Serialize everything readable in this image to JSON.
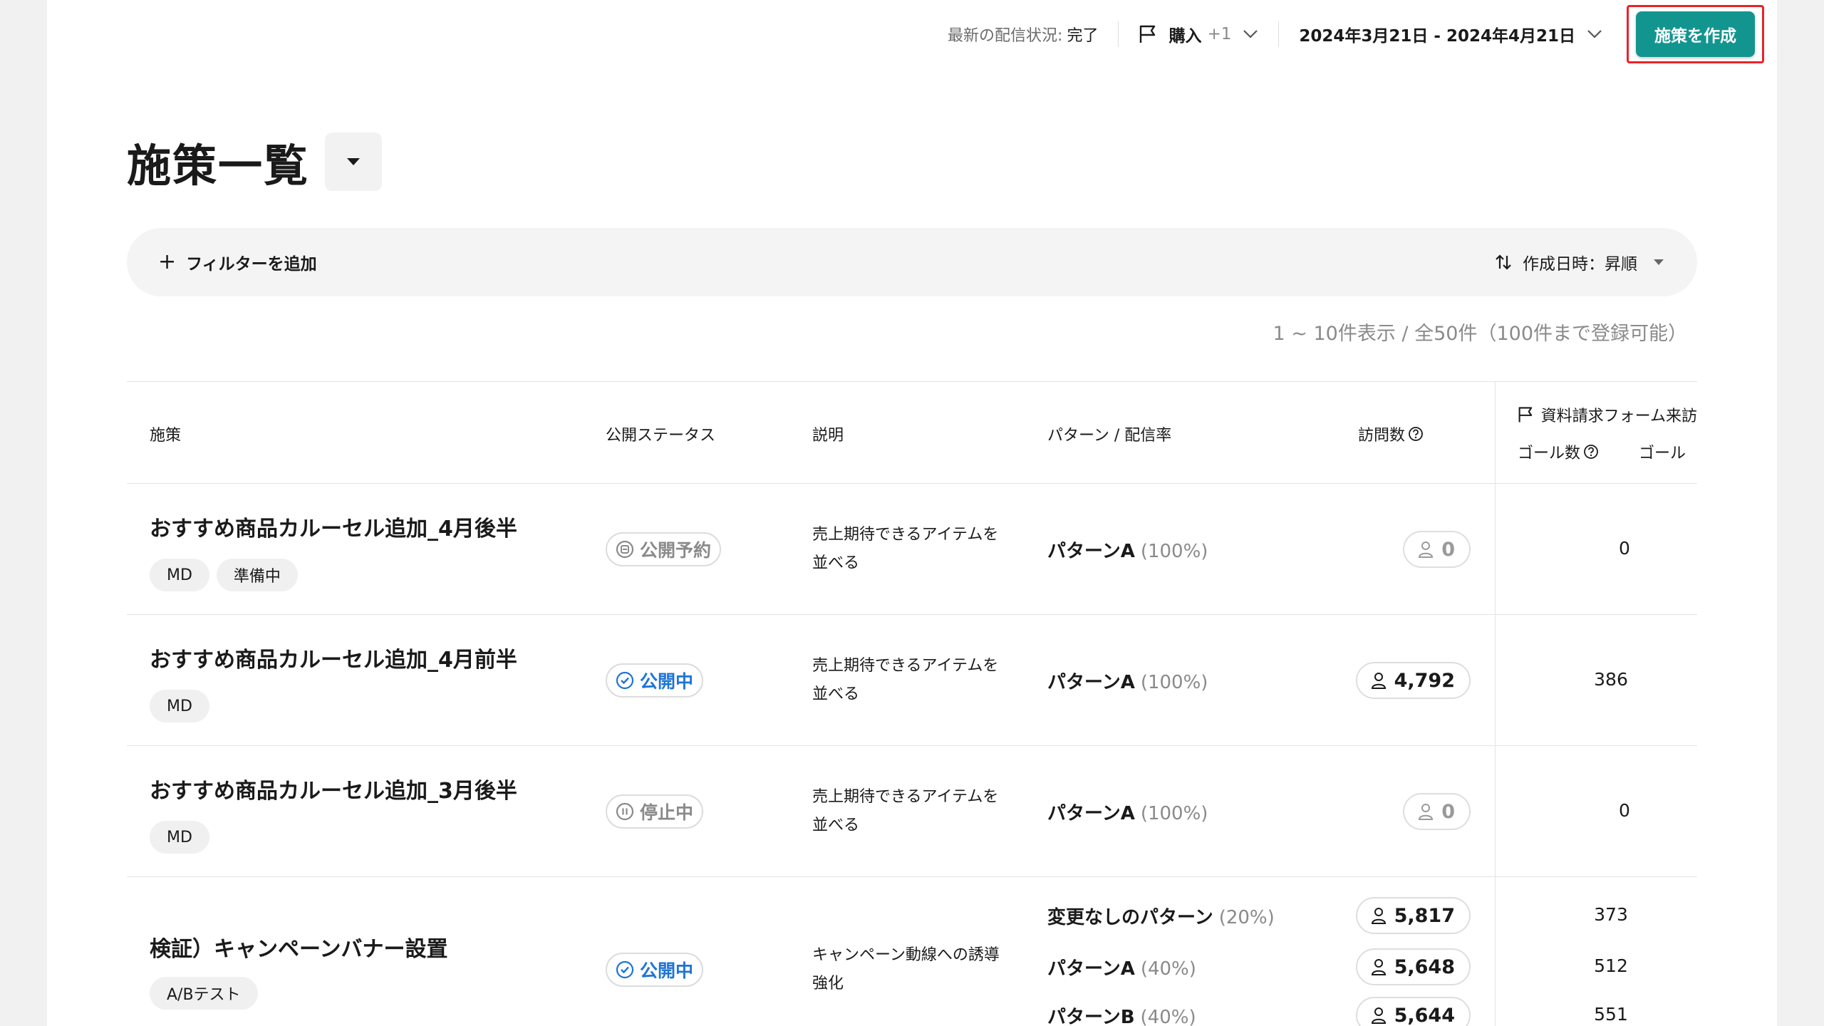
{
  "header": {
    "delivery_label": "最新の配信状況:",
    "delivery_value": "完了",
    "goal_selector": "購入",
    "goal_extra": "+1",
    "date_range": "2024年3月21日 - 2024年4月21日",
    "create_button": "施策を作成"
  },
  "title": "施策一覧",
  "filter": {
    "add_filter": "フィルターを追加",
    "sort_label": "作成日時：昇順"
  },
  "count_text": "1 ~ 10件表示 / 全50件（100件まで登録可能）",
  "table": {
    "columns": {
      "name": "施策",
      "status": "公開ステータス",
      "description": "説明",
      "pattern": "パターン / 配信率",
      "visits": "訪問数",
      "goal_group": "資料請求フォーム来訪",
      "goal_count": "ゴール数",
      "goal_rate": "ゴール"
    },
    "rows": [
      {
        "name": "おすすめ商品カルーセル追加_4月後半",
        "tags": [
          "MD",
          "準備中"
        ],
        "status": "公開予約",
        "description": "売上期待できるアイテムを並べる",
        "patterns": [
          {
            "name": "パターンA",
            "rate": "(100%)",
            "visits": "0",
            "goal": "0"
          }
        ]
      },
      {
        "name": "おすすめ商品カルーセル追加_4月前半",
        "tags": [
          "MD"
        ],
        "status": "公開中",
        "description": "売上期待できるアイテムを並べる",
        "patterns": [
          {
            "name": "パターンA",
            "rate": "(100%)",
            "visits": "4,792",
            "goal": "386"
          }
        ]
      },
      {
        "name": "おすすめ商品カルーセル追加_3月後半",
        "tags": [
          "MD"
        ],
        "status": "停止中",
        "description": "売上期待できるアイテムを並べる",
        "patterns": [
          {
            "name": "パターンA",
            "rate": "(100%)",
            "visits": "0",
            "goal": "0"
          }
        ]
      },
      {
        "name": "検証）キャンペーンバナー設置",
        "tags": [
          "A/Bテスト"
        ],
        "status": "公開中",
        "description": "キャンペーン動線への誘導強化",
        "patterns": [
          {
            "name": "変更なしのパターン",
            "rate": "(20%)",
            "visits": "5,817",
            "goal": "373"
          },
          {
            "name": "パターンA",
            "rate": "(40%)",
            "visits": "5,648",
            "goal": "512"
          },
          {
            "name": "パターンB",
            "rate": "(40%)",
            "visits": "5,644",
            "goal": "551"
          }
        ]
      }
    ]
  },
  "colors": {
    "primary": "#13958f",
    "highlight": "#e8232a",
    "status_active": "#1e74d6",
    "status_inactive": "#8a8a8a"
  }
}
